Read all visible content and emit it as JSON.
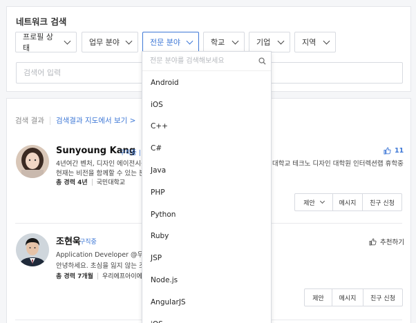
{
  "search": {
    "title": "네트워크 검색",
    "filters": [
      {
        "label": "프로필 상태"
      },
      {
        "label": "업무 분야"
      },
      {
        "label": "전문 분야"
      },
      {
        "label": "학교"
      },
      {
        "label": "기업"
      },
      {
        "label": "지역"
      }
    ],
    "keyword_placeholder": "검색어 입력"
  },
  "results": {
    "label": "검색 결과",
    "map_link": "검색결과 지도에서 보기 >"
  },
  "dropdown": {
    "search_placeholder": "전문 분야를 검색해보세요",
    "items": [
      "Android",
      "iOS",
      "C++",
      "C#",
      "Java",
      "PHP",
      "Python",
      "Ruby",
      "JSP",
      "Node.js",
      "AngularJS",
      "iOS"
    ]
  },
  "profiles": [
    {
      "name": "Sunyoung Kang",
      "status": "구직중 | 프",
      "line1_left": "4년여간 벤처, 디자인 에이전시를 거",
      "line1_right": "대학교 테크노 디자인 대학원 인터렉션랩 휴학중이며,",
      "line2": "현재는 비전을 함께할 수 있는 분들을",
      "experience": "총 경력 4년",
      "school": "국민대학교",
      "likes": "11",
      "buttons": [
        "제안",
        "메시지",
        "친구 신청"
      ]
    },
    {
      "name": "조현욱",
      "status": "구직중",
      "line1_left": "Application Developer  @우리에프",
      "line2": "안녕하세요. 초심을 잃지 않는 조현욱",
      "experience": "총 경력 7개월",
      "company": "우리에프아이에스",
      "recommend": "추천하기",
      "buttons": [
        "제안",
        "메시지",
        "친구 신청"
      ]
    }
  ],
  "colors": {
    "accent": "#3d77d6",
    "border": "#d7dae0",
    "background": "#f5f6f8"
  }
}
